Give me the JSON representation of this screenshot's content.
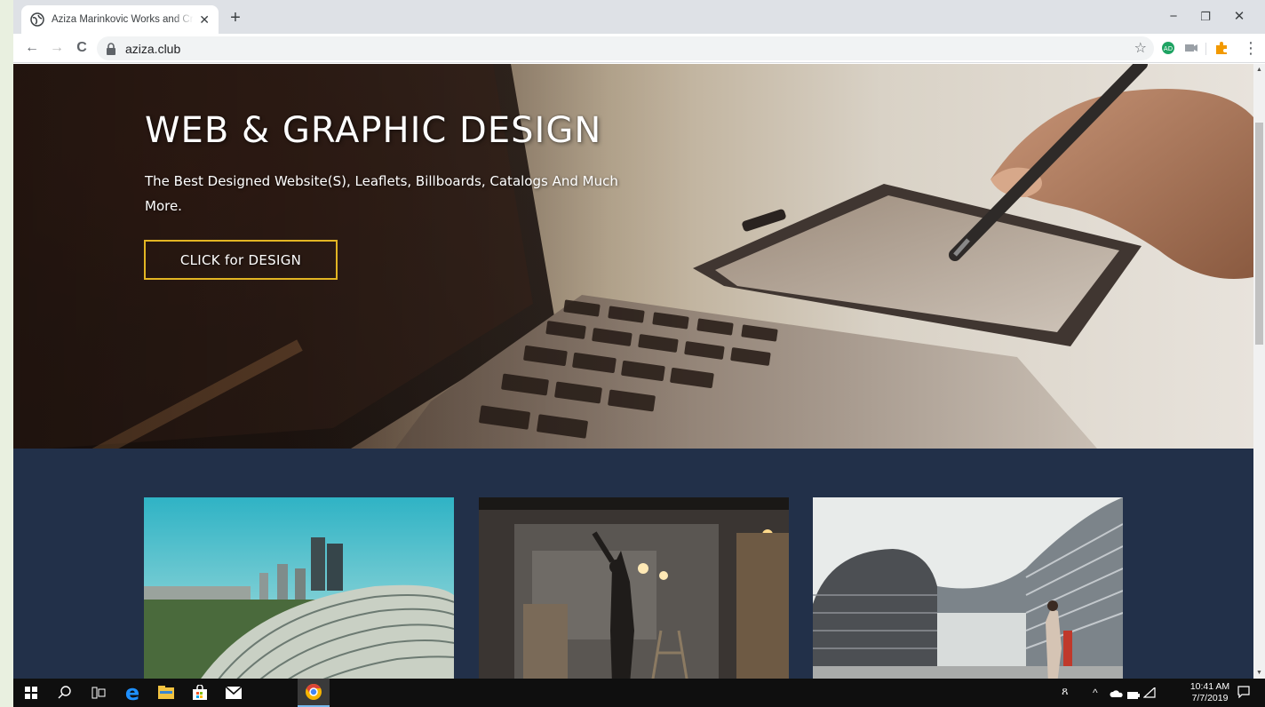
{
  "browser": {
    "tab_title": "Aziza Marinkovic Works and Creative",
    "tab_close": "✕",
    "new_tab": "+",
    "url": "aziza.club",
    "window_controls": {
      "minimize": "−",
      "restore": "❐",
      "close": "✕"
    },
    "nav": {
      "back": "←",
      "forward": "→",
      "reload": "C"
    },
    "bookmark_star": "☆",
    "menu": "⋮"
  },
  "hero": {
    "title": "WEB & GRAPHIC DESIGN",
    "subtitle": "The Best Designed Website(S), Leaflets, Billboards, Catalogs And Much More.",
    "cta_label": "CLICK for DESIGN",
    "accent_color": "#e2b523"
  },
  "gallery": {
    "background": "#223049",
    "cards": [
      {
        "icon": "architecture-photo-dome"
      },
      {
        "icon": "construction-worker-photo"
      },
      {
        "icon": "modern-building-photo"
      }
    ]
  },
  "taskbar": {
    "clock_time": "10:41 AM",
    "clock_date": "7/7/2019",
    "apps": [
      "windows-start-icon",
      "search-icon",
      "task-view-icon",
      "edge-icon",
      "file-explorer-icon",
      "store-icon",
      "mail-icon",
      "chrome-icon"
    ]
  }
}
